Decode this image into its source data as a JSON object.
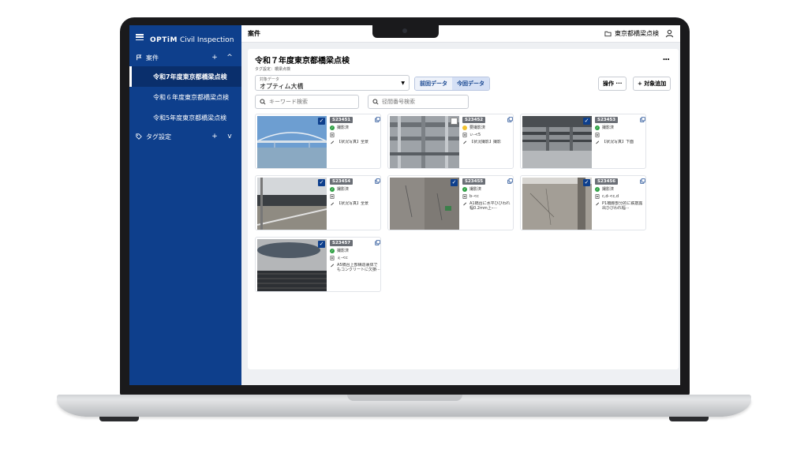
{
  "sidebar": {
    "logo_brand": "OPTiM",
    "logo_product": "Civil Inspection",
    "cases_label": "案件",
    "cases_add": "+",
    "cases_toggle": "^",
    "items": [
      "令和7年度東京都橋梁点検",
      "令和６年度東京都橋梁点検",
      "令和5年度東京都橋梁点検"
    ],
    "tags_label": "タグ設定",
    "tags_add": "+",
    "tags_toggle": "v"
  },
  "topbar": {
    "title": "案件",
    "context": "東京都橋梁点検"
  },
  "panel": {
    "title": "令和７年度東京都橋梁点検",
    "subtitle": "タグ設定：橋梁点検",
    "more": "...",
    "select_caption": "対象データ",
    "select_value": "オプティム大橋",
    "seg_prev": "前回データ",
    "seg_curr": "今回データ",
    "btn_operation": "操作 ···",
    "btn_add": "+ 対象追加",
    "search_keyword_placeholder": "キーワード検索",
    "search_bridge_placeholder": "径間番号検索"
  },
  "cards": [
    {
      "id": "S23451",
      "status": "撮影済",
      "status_color": "green",
      "file": "",
      "memo": "【状況写真】全景",
      "checked": true
    },
    {
      "id": "S23452",
      "status": "要撮影済",
      "status_color": "yellow",
      "file": "ぃ-<5",
      "memo": "【状況撮影】撮影",
      "checked": false
    },
    {
      "id": "S23453",
      "status": "撮影済",
      "status_color": "green",
      "file": "",
      "memo": "【状況写真】下面",
      "checked": true
    },
    {
      "id": "S23454",
      "status": "撮影済",
      "status_color": "green",
      "file": "",
      "memo": "【状況写真】全景",
      "checked": true
    },
    {
      "id": "S23455",
      "status": "撮影済",
      "status_color": "green",
      "file": "b-<c",
      "memo": "A1橋台に水平ひびわれ幅0.2mm上ｰ···",
      "checked": true
    },
    {
      "id": "S23456",
      "status": "撮影済",
      "status_color": "green",
      "file": "c,d-<c,d",
      "memo": "P1橋脚部分的に鉄筋露出ひびわれ幅···",
      "checked": true
    },
    {
      "id": "S23457",
      "status": "撮影済",
      "status_color": "green",
      "file": "ぇ-<c",
      "memo": "A5橋台上部構造裏体でもコンクリートに欠損···",
      "checked": true
    }
  ]
}
